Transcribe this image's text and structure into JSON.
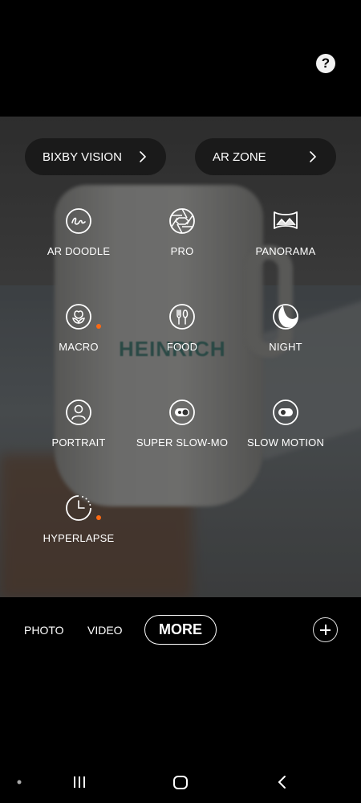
{
  "top": {
    "help_icon": "question-mark-icon",
    "help_glyph": "?"
  },
  "viewfinder": {
    "scene_text": "HEINRICH"
  },
  "shortcuts": {
    "bixby": "BIXBY VISION",
    "ar_zone": "AR ZONE"
  },
  "modes": {
    "ar_doodle": "AR DOODLE",
    "pro": "PRO",
    "panorama": "PANORAMA",
    "macro": "MACRO",
    "food": "FOOD",
    "night": "NIGHT",
    "portrait": "PORTRAIT",
    "super_slow_mo": "SUPER SLOW-MO",
    "slow_motion": "SLOW MOTION",
    "hyperlapse": "HYPERLAPSE"
  },
  "bottom": {
    "photo": "PHOTO",
    "video": "VIDEO",
    "more": "MORE"
  },
  "colors": {
    "badge": "#ff6a13",
    "background": "#000000"
  }
}
